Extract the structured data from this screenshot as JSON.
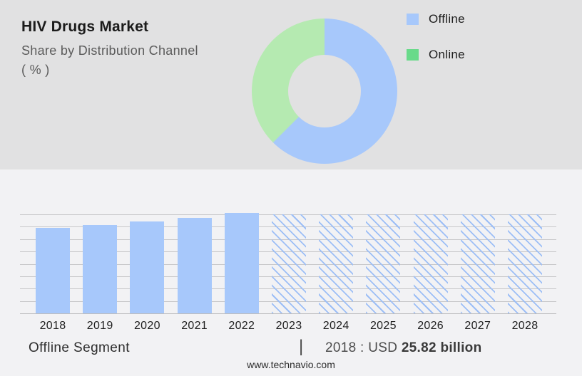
{
  "header": {
    "title": "HIV Drugs Market",
    "subtitle_line1": "Share by Distribution Channel",
    "subtitle_line2": "( % )"
  },
  "legend": {
    "items": [
      {
        "label": "Offline",
        "color": "#a7c8fb"
      },
      {
        "label": "Online",
        "color": "#69da8a"
      }
    ]
  },
  "caption": {
    "segment_label": "Offline Segment",
    "separator": "|",
    "annotation_prefix": "2018 : USD ",
    "annotation_value": "25.82 billion"
  },
  "footer": {
    "url": "www.technavio.com"
  },
  "colors": {
    "top_background": "#e1e1e2",
    "bottom_background": "#f2f2f4",
    "bar_blue": "#a7c8fb",
    "donut_green": "#b5eab1",
    "legend_green": "#69da8a",
    "hatch_line": "#9cbef6",
    "gridline": "#c7c7c9"
  },
  "chart_data": [
    {
      "type": "pie",
      "subtype": "donut",
      "title": "HIV Drugs Market - Share by Distribution Channel (%)",
      "legend_position": "right",
      "segments": [
        {
          "label": "Offline",
          "value_pct": 62.5,
          "color": "#a7c8fb"
        },
        {
          "label": "Online",
          "value_pct": 37.5,
          "color": "#b5eab1"
        }
      ],
      "start_angle_deg": 0,
      "direction": "clockwise"
    },
    {
      "type": "bar",
      "title": "Offline Segment market size by year",
      "categories": [
        "2018",
        "2019",
        "2020",
        "2021",
        "2022",
        "2023",
        "2024",
        "2025",
        "2026",
        "2027",
        "2028"
      ],
      "relative_heights": [
        0.86,
        0.89,
        0.93,
        0.965,
        1.015,
        1,
        1,
        1,
        1,
        1,
        1
      ],
      "forecast_start_index": 5,
      "solid_years": [
        "2018",
        "2019",
        "2020",
        "2021",
        "2022"
      ],
      "hatched_forecast_years": [
        "2023",
        "2024",
        "2025",
        "2026",
        "2027",
        "2028"
      ],
      "known_values": [
        {
          "year": "2018",
          "value": "USD 25.82 billion"
        }
      ],
      "xlabel": "",
      "ylabel": "",
      "y_axis_labels_visible": false,
      "gridline_count": 9,
      "grid": true,
      "legend_position": "none"
    }
  ]
}
